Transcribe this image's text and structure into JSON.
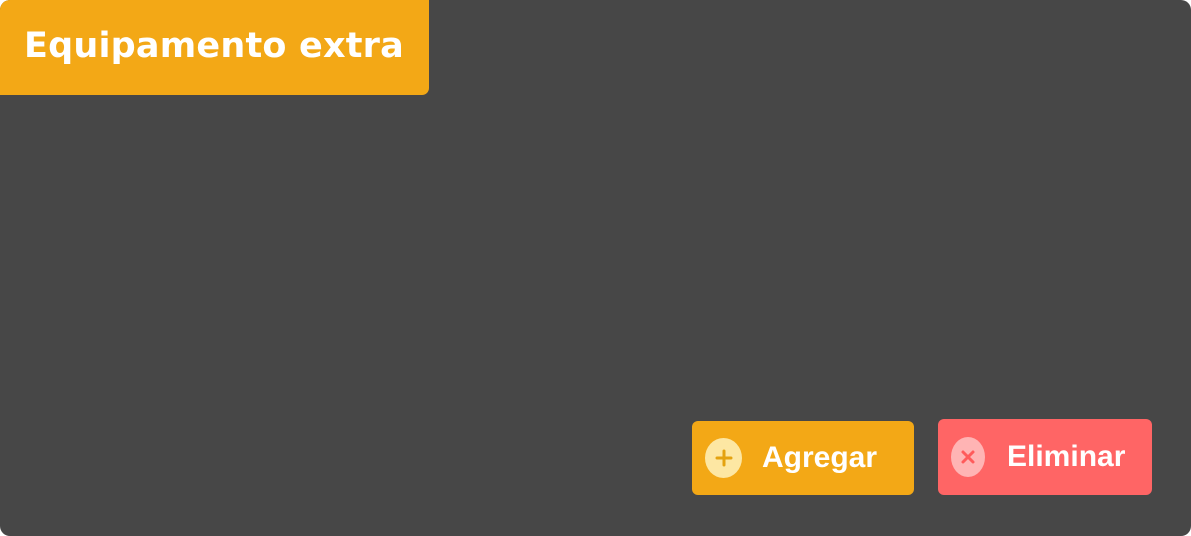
{
  "panel": {
    "title": "Equipamento extra"
  },
  "actions": {
    "add_label": "Agregar",
    "add_icon": "plus-icon",
    "delete_label": "Eliminar",
    "delete_icon": "x-icon"
  },
  "colors": {
    "panel_background": "#474747",
    "accent": "#f3a816",
    "danger": "#ff6565",
    "add_icon_background": "#fde7a3",
    "delete_icon_background": "#ffb4b4",
    "text": "#ffffff"
  }
}
